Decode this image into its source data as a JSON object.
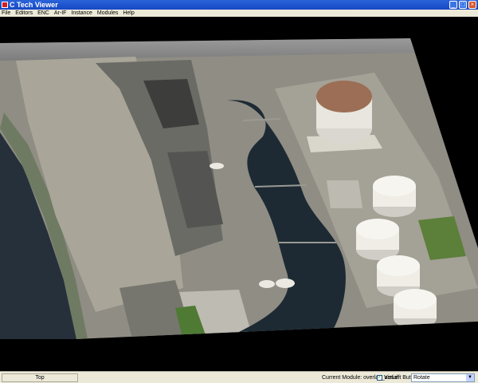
{
  "window": {
    "title": "C Tech Viewer",
    "minimize": "_",
    "maximize": "□",
    "close": "×"
  },
  "menu": {
    "items": [
      "File",
      "Editors",
      "ENC",
      "Ar-IF",
      "Instance",
      "Modules",
      "Help"
    ]
  },
  "viewport": {
    "description_icon": "aerial-overlay-surface"
  },
  "status": {
    "view_label": "Top",
    "module_label": "Current Module: overlay_aerial",
    "viz_checkbox_mark": "✓",
    "viz_label": "VizLeft Button",
    "mode_value": "Rotate",
    "dropdown_arrow": "▼"
  },
  "colors": {
    "titlebar": "#1648c4",
    "chrome": "#ece9d8",
    "viewport_bg": "#000000"
  }
}
